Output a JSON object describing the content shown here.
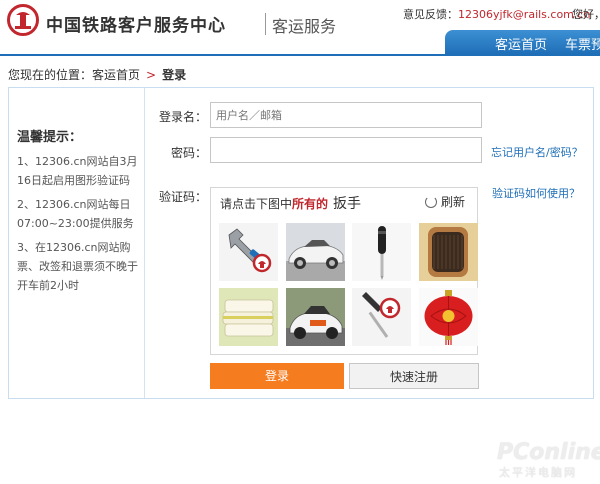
{
  "header": {
    "site_name": "中国铁路客户服务中心",
    "site_sub": "客运服务",
    "feedback_label": "意见反馈：",
    "feedback_email": "12306yjfk@rails.com.cn",
    "hello": "您好，",
    "nav": [
      "客运首页",
      "车票预"
    ]
  },
  "breadcrumb": {
    "prefix": "您现在的位置：",
    "home": "客运首页",
    "separator": ">",
    "current": "登录"
  },
  "tips": {
    "title": "温馨提示：",
    "items": [
      "1、12306.cn网站自3月16日起启用图形验证码",
      "2、12306.cn网站每日07:00~23:00提供服务",
      "3、在12306.cn网站购票、改签和退票须不晚于开车前2小时"
    ]
  },
  "form": {
    "username_label": "登录名：",
    "username_placeholder": "用户名／邮箱",
    "password_label": "密码：",
    "forgot_link": "忘记用户名/密码？",
    "captcha_label": "验证码：",
    "captcha_help_link": "验证码如何使用？",
    "captcha_prompt_1": "请点击下图中",
    "captcha_prompt_2": "所有的",
    "captcha_word": "扳手",
    "refresh_label": "刷新",
    "captcha_images": [
      "wrench",
      "white sports car",
      "screwdriver",
      "brush",
      "towels",
      "rally car",
      "screwdriver",
      "red lantern"
    ],
    "login_button": "登录",
    "register_button": "快速注册"
  },
  "watermark": {
    "main": "PConline",
    "sub": "太平洋电脑网"
  },
  "colors": {
    "brand_red": "#c1272d",
    "nav_blue": "#1f6fb8",
    "login_orange": "#f57c1f"
  }
}
